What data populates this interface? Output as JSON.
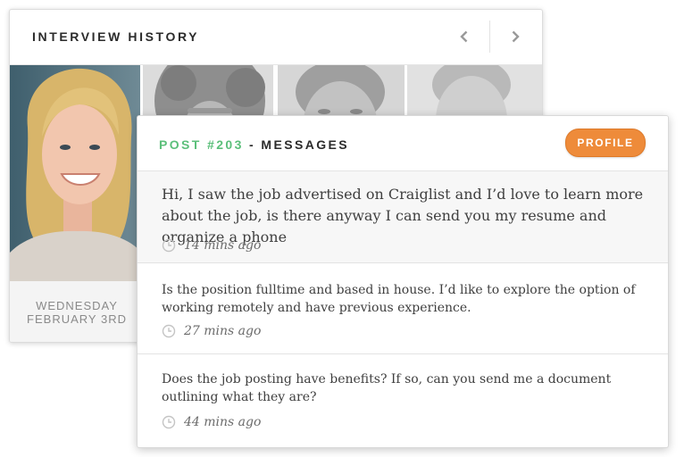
{
  "history": {
    "title": "INTERVIEW HISTORY",
    "prev_icon": "chevron-left-icon",
    "next_icon": "chevron-right-icon",
    "date_day": "WEDNESDAY",
    "date_full": "FEBRUARY 3RD"
  },
  "messages_panel": {
    "post_id": "POST #203",
    "post_sep": " - ",
    "post_label": "MESSAGES",
    "profile_label": "PROFILE",
    "accent_green": "#5bbf7a",
    "accent_orange": "#ee8b3a",
    "messages": [
      {
        "text": "Hi, I saw the job advertised on Craiglist and I’d love to learn more about the job, is there anyway I can send you my resume and organize a phone",
        "time": "14 mins ago"
      },
      {
        "text": "Is the position fulltime and based in house. I’d like to explore the option of working remotely and have previous experience.",
        "time": "27 mins ago"
      },
      {
        "text": "Does the job posting have benefits? If so, can you send me a document outlining what they are?",
        "time": "44 mins ago"
      }
    ]
  }
}
